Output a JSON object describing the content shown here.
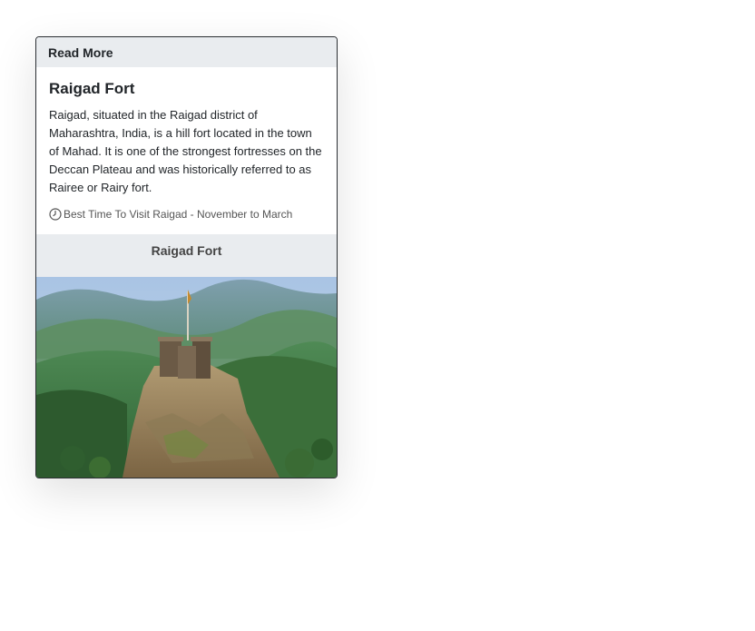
{
  "card": {
    "header": "Read More",
    "title": "Raigad Fort",
    "description": "Raigad, situated in the Raigad district of Maharashtra, India, is a hill fort located in the town of Mahad. It is one of the strongest fortresses on the Deccan Plateau and was historically referred to as Rairee or Rairy fort.",
    "best_time": "Best Time To Visit Raigad - November to March",
    "best_time_icon": "clock-icon",
    "image_caption": "Raigad Fort",
    "image_subject": "fort-photo"
  },
  "colors": {
    "header_bg": "#e9ecef",
    "text": "#212529",
    "muted": "#555555"
  }
}
